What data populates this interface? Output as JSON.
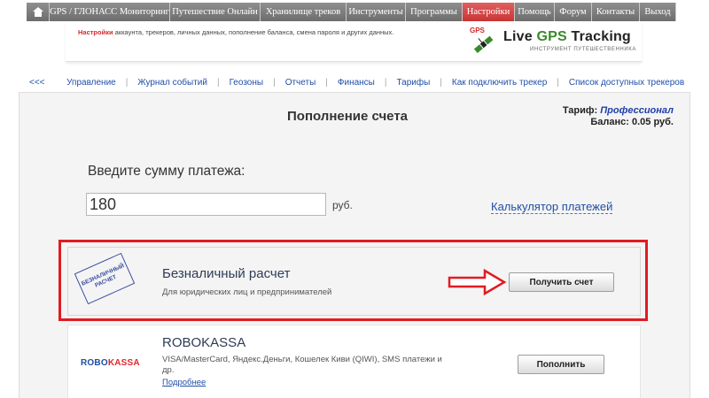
{
  "nav": {
    "items": [
      {
        "label": "GPS / ГЛОНАСС Мониторинг",
        "active": false
      },
      {
        "label": "Путешествие Онлайн",
        "active": false
      },
      {
        "label": "Хранилище треков",
        "active": false
      },
      {
        "label": "Инструменты",
        "active": false
      },
      {
        "label": "Программы",
        "active": false
      },
      {
        "label": "Настройки",
        "active": true
      },
      {
        "label": "Помощь",
        "active": false
      },
      {
        "label": "Форум",
        "active": false
      },
      {
        "label": "Контакты",
        "active": false
      },
      {
        "label": "Выход",
        "active": false
      }
    ]
  },
  "banner": {
    "highlight": "Настройки",
    "text": " аккаунта, трекеров, личных данных, пополнение баланса, смена пароля и других данных.",
    "logo_badge": "GPS",
    "logo_prefix": "Live ",
    "logo_gps": "GPS",
    "logo_suffix": " Tracking",
    "logo_subtitle": "ИНСТРУМЕНТ ПУТЕШЕСТВЕННИКА"
  },
  "subnav": {
    "back": "<<<",
    "items": [
      "Управление",
      "Журнал событий",
      "Геозоны",
      "Отчеты",
      "Финансы",
      "Тарифы",
      "Как подключить трекер",
      "Список доступных трекеров"
    ]
  },
  "page": {
    "title": "Пополнение счета",
    "tariff_label": "Тариф:",
    "tariff_value": "Профессионал",
    "balance_label": "Баланс:",
    "balance_value": "0.05 руб.",
    "amount_label": "Введите сумму платежа:",
    "amount_value": "180",
    "currency": "руб.",
    "calculator_link": "Калькулятор платежей"
  },
  "options": {
    "bank": {
      "stamp_line1": "БЕЗНАЛИЧНЫЙ",
      "stamp_line2": "РАСЧЕТ",
      "title": "Безналичный расчет",
      "description": "Для юридических лиц и предпринимателей",
      "button": "Получить счет"
    },
    "robokassa": {
      "logo_part1": "ROBO",
      "logo_part2": "KASSA",
      "title": "ROBOKASSA",
      "description_line1": "VISA/MasterCard, Яндекс.Деньги, Кошелек Киви (QIWI), SMS платежи и",
      "description_line2": "др.",
      "more_link": "Подробнее",
      "button": "Пополнить"
    }
  },
  "colors": {
    "nav_bg": "#7d7d7d",
    "nav_active": "#d43a3a",
    "link": "#1f4fa8",
    "highlight_border": "#e21b22",
    "tariff_value": "#1f3fa8"
  }
}
